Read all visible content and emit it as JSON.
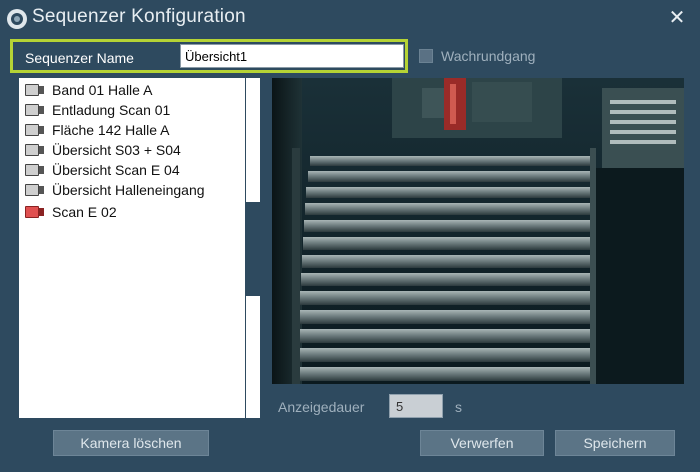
{
  "window": {
    "title": "Sequenzer Konfiguration",
    "close_glyph": "✕"
  },
  "name_field": {
    "label": "Sequenzer Name",
    "value": "Übersicht1"
  },
  "patrol_checkbox": {
    "label": "Wachrundgang",
    "checked": false
  },
  "camera_list": [
    {
      "label": "Band 01 Halle A",
      "status": "inactive"
    },
    {
      "label": "Entladung Scan 01",
      "status": "inactive"
    },
    {
      "label": "Fläche 142 Halle A",
      "status": "inactive"
    },
    {
      "label": "Übersicht S03 + S04",
      "status": "inactive"
    },
    {
      "label": "Übersicht Scan E 04",
      "status": "inactive"
    },
    {
      "label": "Übersicht Halleneingang",
      "status": "inactive"
    },
    {
      "label": "Scan E 02",
      "status": "active"
    }
  ],
  "duration": {
    "label": "Anzeigedauer",
    "value": "5",
    "unit": "s"
  },
  "buttons": {
    "delete_camera": "Kamera löschen",
    "discard": "Verwerfen",
    "save": "Speichern"
  },
  "colors": {
    "background": "#2e4a5f",
    "highlight": "#b5d335",
    "button": "#5b7486"
  }
}
